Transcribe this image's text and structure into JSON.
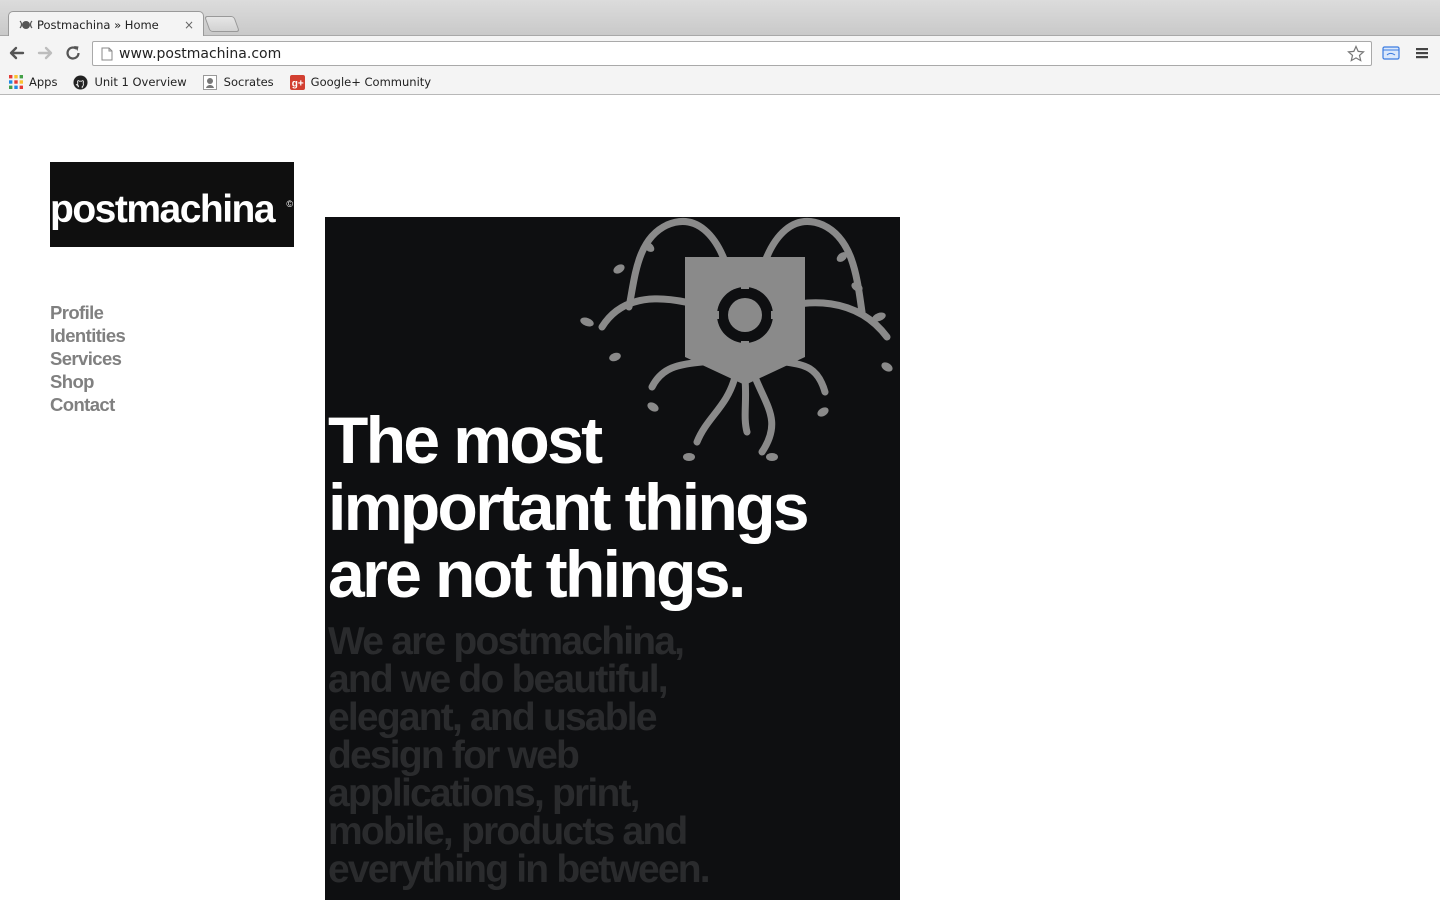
{
  "browser": {
    "tab": {
      "title": "Postmachina » Home",
      "close_glyph": "×"
    },
    "url": "www.postmachina.com",
    "bookmarks": [
      {
        "label": "Apps",
        "icon": "apps-grid-icon"
      },
      {
        "label": "Unit 1 Overview",
        "icon": "github-icon"
      },
      {
        "label": "Socrates",
        "icon": "socrates-icon"
      },
      {
        "label": "Google+ Community",
        "icon": "google-plus-icon"
      }
    ]
  },
  "site": {
    "logo": {
      "text": "postmachina",
      "mark": "©"
    },
    "nav": [
      "Profile",
      "Identities",
      "Services",
      "Shop",
      "Contact"
    ],
    "hero": {
      "headline_lines": [
        "The most",
        "important things",
        "are not things."
      ],
      "sub_lines": [
        "We are postmachina,",
        "and we do beautiful,",
        "elegant, and usable",
        "design for web",
        "applications, print,",
        "mobile, products and",
        "everything in between."
      ]
    }
  },
  "colors": {
    "hero_bg": "#0e0f11",
    "nav_text": "#808080",
    "sub_text": "#2a2b2d",
    "art": "#8a8a8a"
  }
}
